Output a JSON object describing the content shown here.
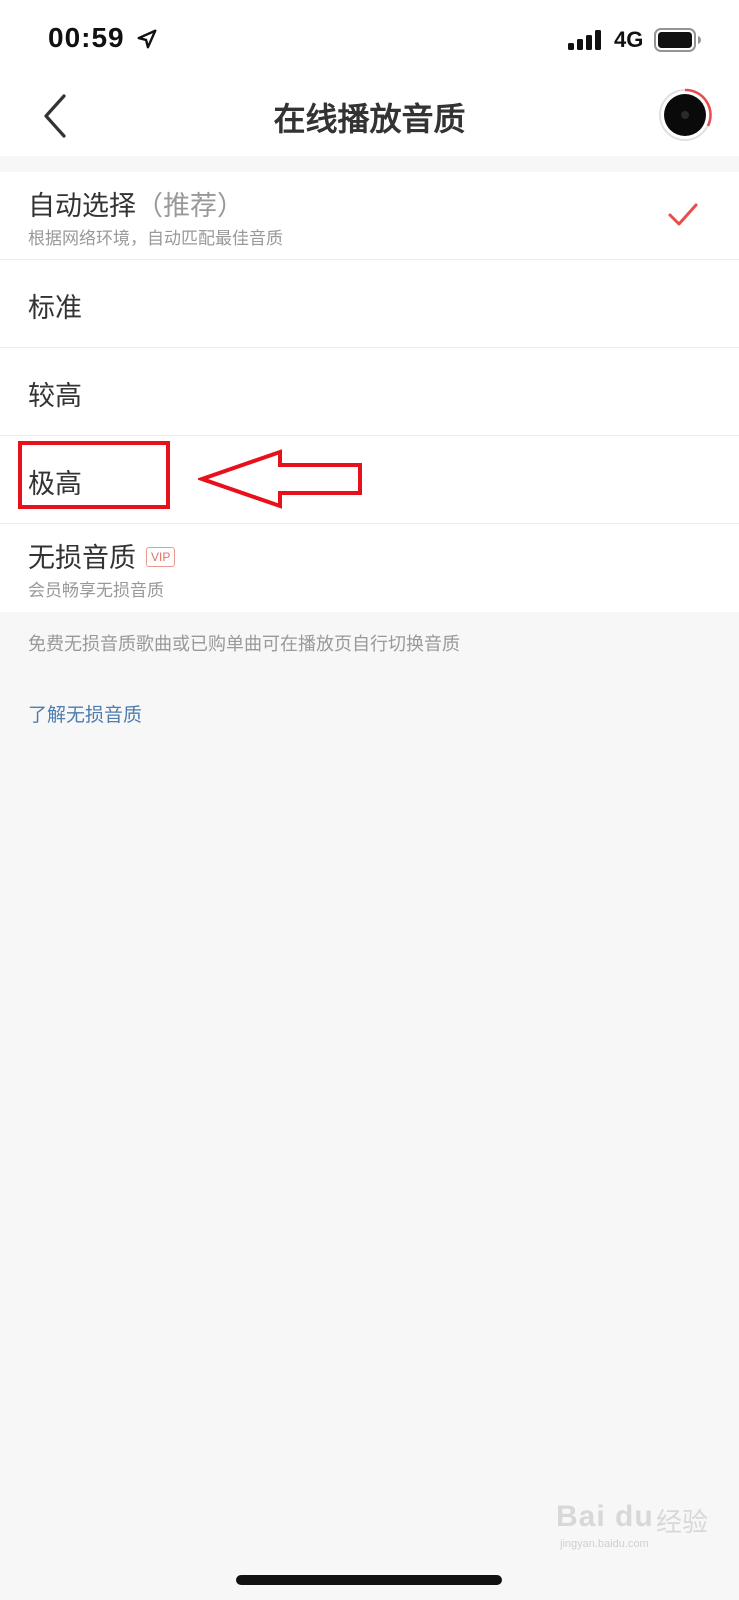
{
  "status_bar": {
    "time": "00:59",
    "network": "4G"
  },
  "nav": {
    "title": "在线播放音质"
  },
  "options": [
    {
      "label": "自动选择",
      "hint": "（推荐）",
      "sub": "根据网络环境，自动匹配最佳音质",
      "selected": true
    },
    {
      "label": "标准",
      "selected": false
    },
    {
      "label": "较高",
      "selected": false
    },
    {
      "label": "极高",
      "selected": false
    },
    {
      "label": "无损音质",
      "badge": "VIP",
      "sub": "会员畅享无损音质",
      "selected": false
    }
  ],
  "footer": {
    "note": "免费无损音质歌曲或已购单曲可在播放页自行切换音质",
    "link": "了解无损音质"
  },
  "watermark": {
    "brand": "Bai du",
    "cn": "经验",
    "url": "jingyan.baidu.com"
  },
  "colors": {
    "accent": "#e84c4c",
    "annotation": "#e8101a",
    "link": "#507daf"
  }
}
